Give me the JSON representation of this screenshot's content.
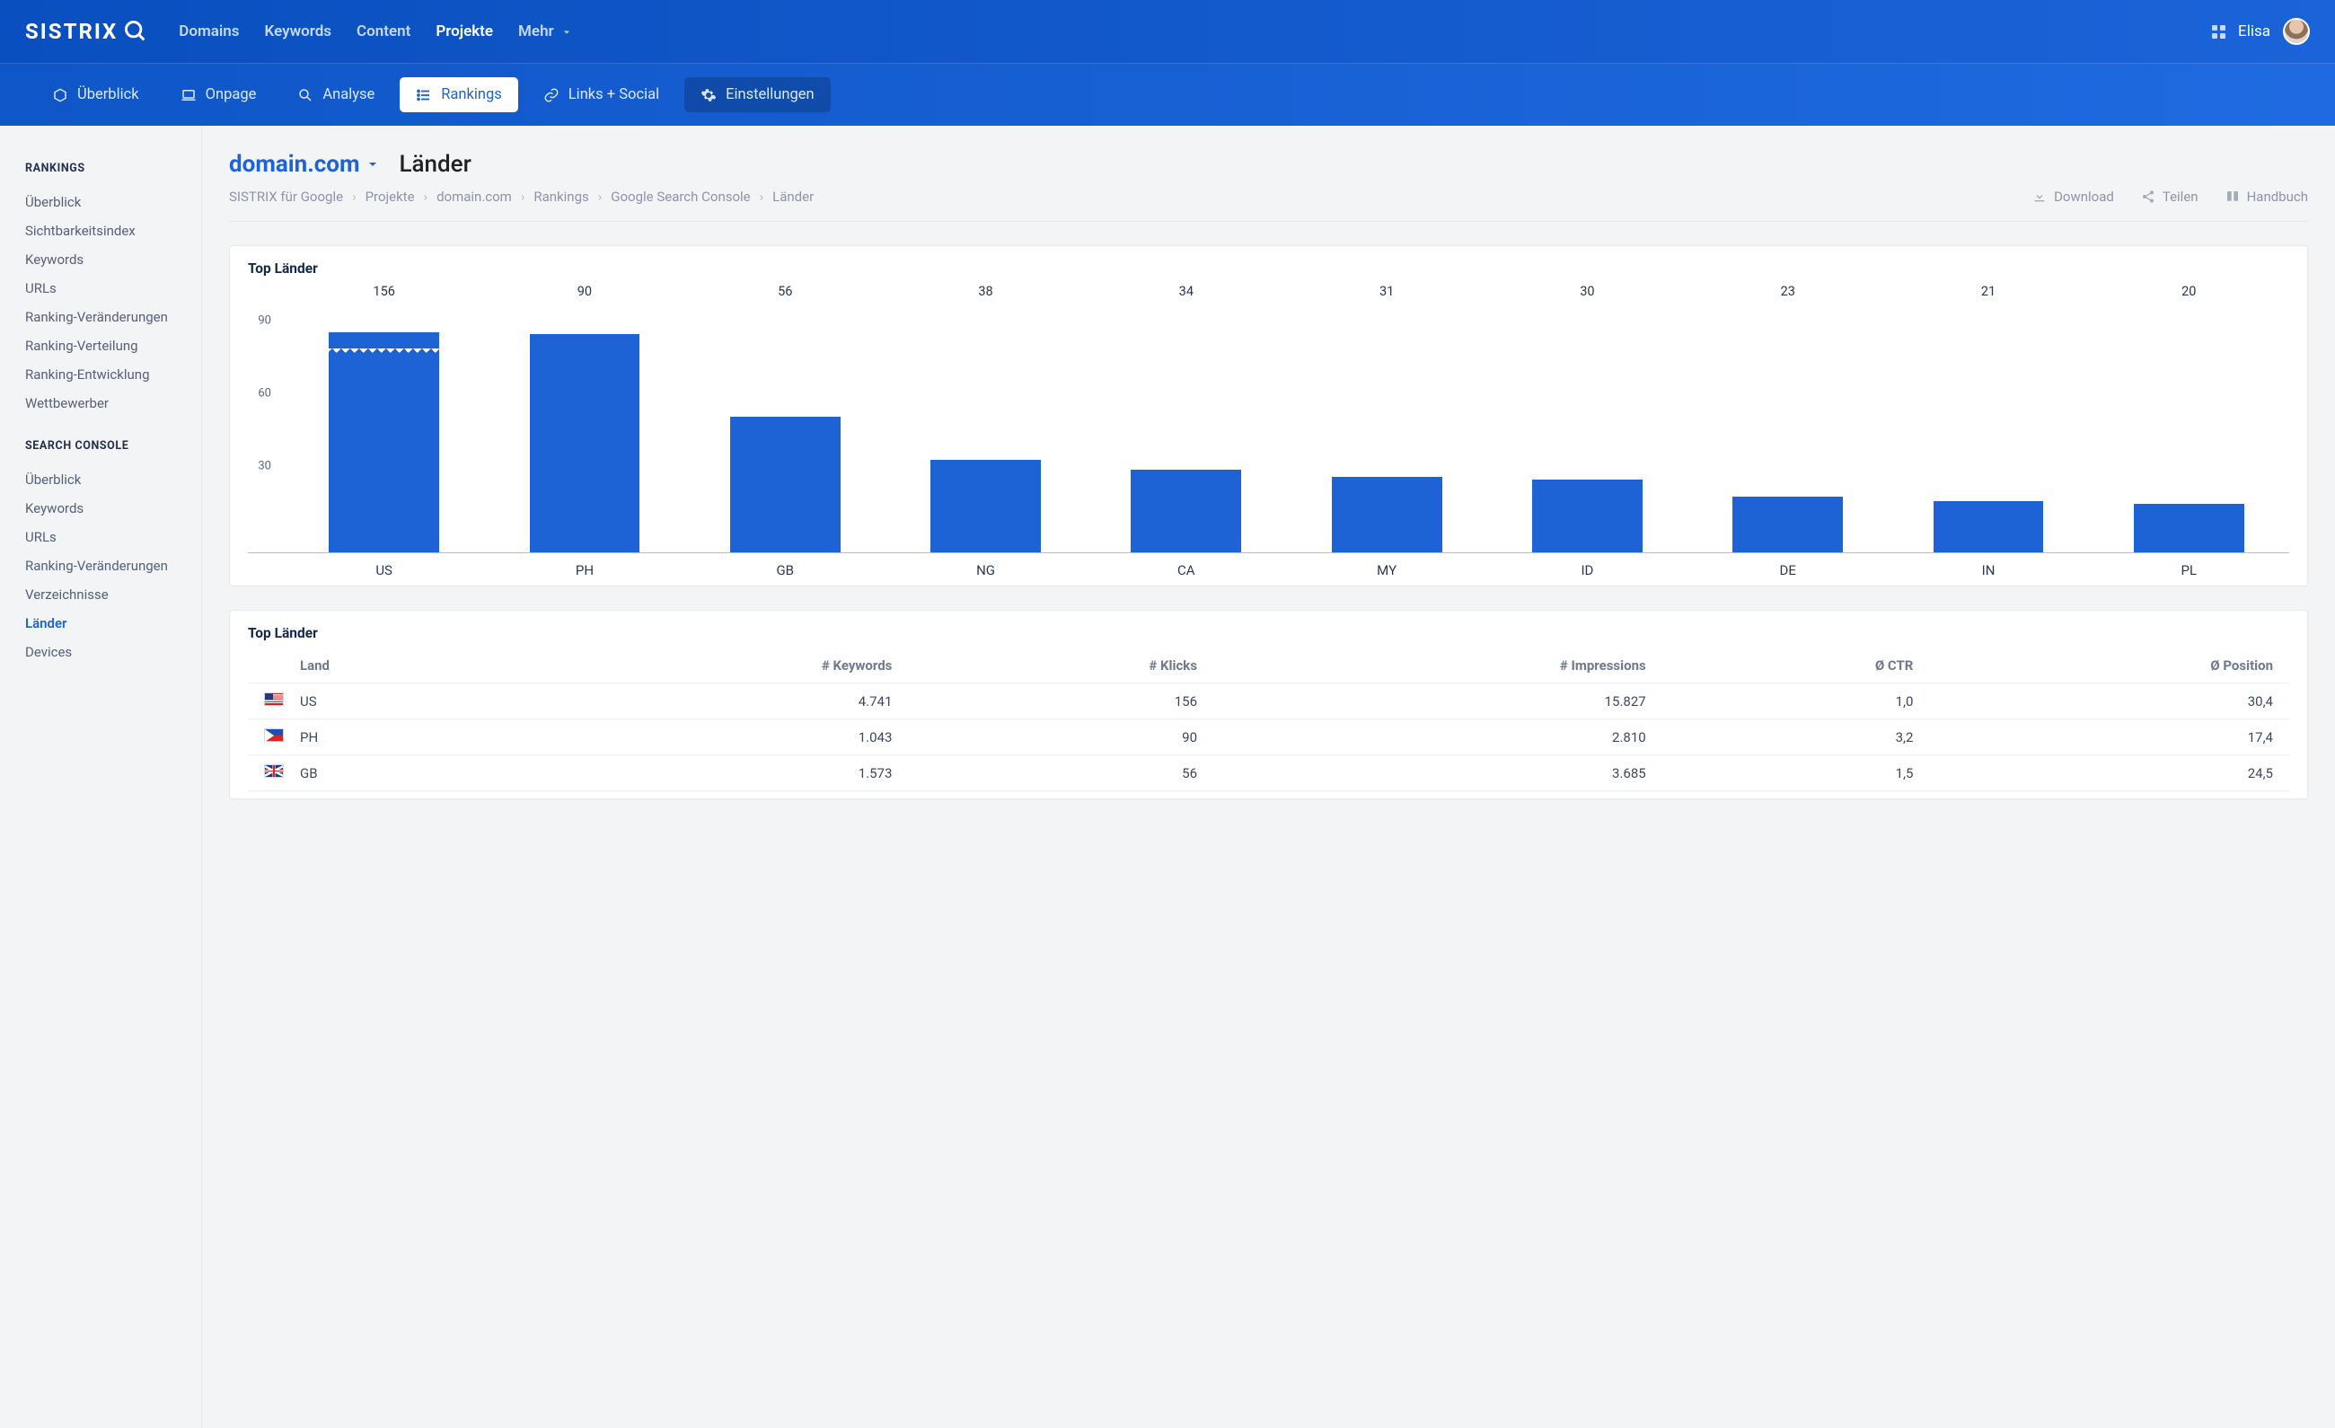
{
  "brand": "SISTRIX",
  "topnav": {
    "items": [
      {
        "label": "Domains",
        "active": false
      },
      {
        "label": "Keywords",
        "active": false
      },
      {
        "label": "Content",
        "active": false
      },
      {
        "label": "Projekte",
        "active": true
      },
      {
        "label": "Mehr",
        "active": false,
        "dropdown": true
      }
    ],
    "user": "Elisa"
  },
  "subnav": {
    "items": [
      {
        "icon": "cube",
        "label": "Überblick"
      },
      {
        "icon": "laptop",
        "label": "Onpage"
      },
      {
        "icon": "search",
        "label": "Analyse"
      },
      {
        "icon": "list",
        "label": "Rankings",
        "active": true
      },
      {
        "icon": "link",
        "label": "Links + Social"
      },
      {
        "icon": "gear",
        "label": "Einstellungen",
        "dark": true
      }
    ]
  },
  "sidebar": {
    "groups": [
      {
        "title": "RANKINGS",
        "items": [
          "Überblick",
          "Sichtbarkeitsindex",
          "Keywords",
          "URLs",
          "Ranking-Veränderungen",
          "Ranking-Verteilung",
          "Ranking-Entwicklung",
          "Wettbewerber"
        ]
      },
      {
        "title": "SEARCH CONSOLE",
        "items": [
          "Überblick",
          "Keywords",
          "URLs",
          "Ranking-Veränderungen",
          "Verzeichnisse",
          "Länder",
          "Devices"
        ],
        "activeIndex": 5
      }
    ]
  },
  "page": {
    "domain": "domain.com",
    "title": "Länder",
    "breadcrumbs": [
      "SISTRIX für Google",
      "Projekte",
      "domain.com",
      "Rankings",
      "Google Search Console",
      "Länder"
    ],
    "actions": {
      "download": "Download",
      "share": "Teilen",
      "handbook": "Handbuch"
    }
  },
  "chart_card_title": "Top Länder",
  "chart_data": {
    "type": "bar",
    "title": "Top Länder",
    "ylabel": "",
    "yticks": [
      30,
      60,
      90
    ],
    "ylim": [
      0,
      100
    ],
    "categories": [
      "US",
      "PH",
      "GB",
      "NG",
      "CA",
      "MY",
      "ID",
      "DE",
      "IN",
      "PL"
    ],
    "values": [
      156,
      90,
      56,
      38,
      34,
      31,
      30,
      23,
      21,
      20
    ],
    "truncated_index": 0
  },
  "table": {
    "title": "Top Länder",
    "headers": [
      "Land",
      "# Keywords",
      "# Klicks",
      "# Impressions",
      "Ø CTR",
      "Ø Position"
    ],
    "rows": [
      {
        "flag": "us",
        "land": "US",
        "keywords": "4.741",
        "klicks": "156",
        "impressions": "15.827",
        "ctr": "1,0",
        "position": "30,4"
      },
      {
        "flag": "ph",
        "land": "PH",
        "keywords": "1.043",
        "klicks": "90",
        "impressions": "2.810",
        "ctr": "3,2",
        "position": "17,4"
      },
      {
        "flag": "gb",
        "land": "GB",
        "keywords": "1.573",
        "klicks": "56",
        "impressions": "3.685",
        "ctr": "1,5",
        "position": "24,5"
      }
    ]
  }
}
